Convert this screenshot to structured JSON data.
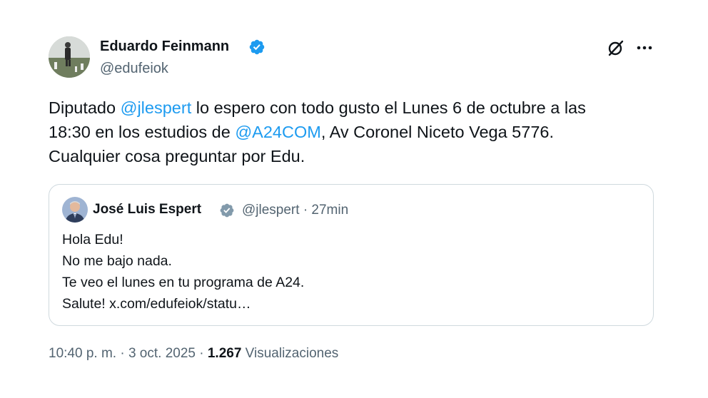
{
  "author": {
    "name": "Eduardo Feinmann",
    "handle": "@edufeiok",
    "verified": true,
    "avatar_icon": "profile-photo-icon"
  },
  "actions": {
    "grok_icon": "grok-icon",
    "more_icon": "more-options-icon"
  },
  "tweet": {
    "lines": [
      [
        {
          "text": "Diputado ",
          "type": "text"
        },
        {
          "text": "@jlespert",
          "type": "mention"
        },
        {
          "text": " lo espero con todo gusto el Lunes 6 de octubre a las",
          "type": "text"
        }
      ],
      [
        {
          "text": "18:30 en los estudios de ",
          "type": "text"
        },
        {
          "text": "@A24COM",
          "type": "mention"
        },
        {
          "text": ", Av Coronel Niceto Vega 5776.",
          "type": "text"
        }
      ],
      [
        {
          "text": "Cualquier cosa preguntar por Edu.",
          "type": "text"
        }
      ]
    ]
  },
  "quoted_tweet": {
    "author_name": "José Luis Espert",
    "verified": true,
    "meta": "@jlespert · 27min",
    "lines": [
      "Hola Edu!",
      "No me bajo nada.",
      "Te veo el lunes en tu programa de A24.",
      "Salute! x.com/edufeiok/statu…"
    ]
  },
  "footer": {
    "time_date": "10:40 p. m. · 3 oct. 2025 · ",
    "views_count": "1.267",
    "views_label": " Visualizaciones"
  },
  "colors": {
    "accent": "#1d9bf0",
    "text_primary": "#0f1419",
    "text_secondary": "#536471",
    "border": "#cfd9de",
    "verified_badge": "#1d9bf0"
  }
}
